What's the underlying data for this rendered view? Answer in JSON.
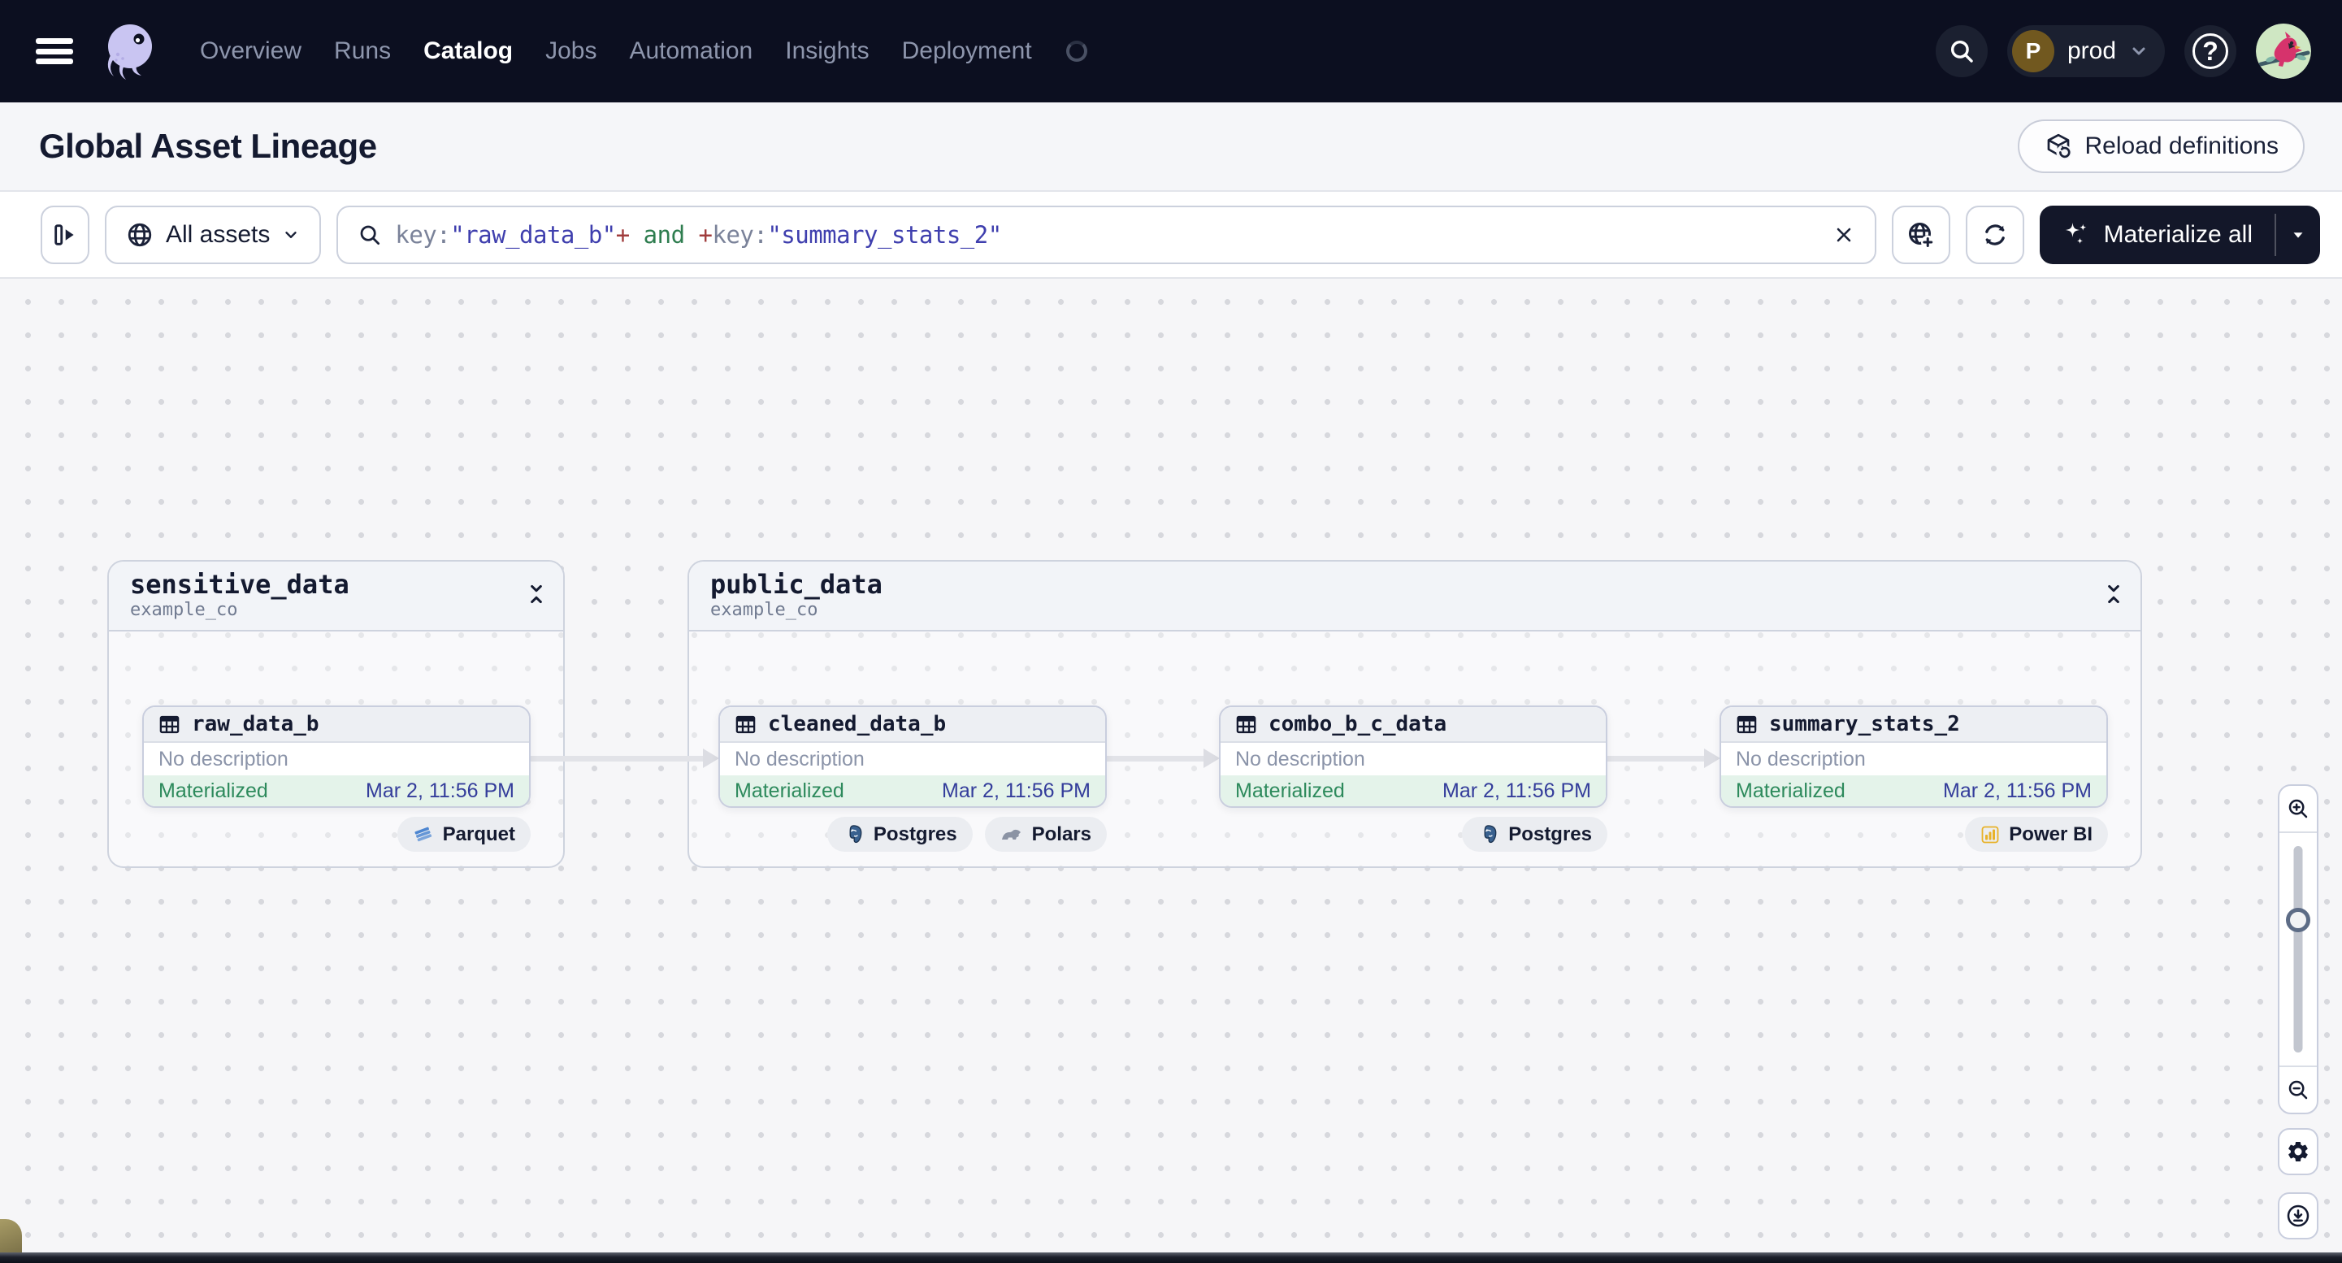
{
  "navbar": {
    "brand": "Dagster",
    "items": [
      {
        "label": "Overview",
        "active": false
      },
      {
        "label": "Runs",
        "active": false
      },
      {
        "label": "Catalog",
        "active": true
      },
      {
        "label": "Jobs",
        "active": false
      },
      {
        "label": "Automation",
        "active": false
      },
      {
        "label": "Insights",
        "active": false
      },
      {
        "label": "Deployment",
        "active": false
      }
    ],
    "deployment": {
      "initial": "P",
      "name": "prod"
    },
    "help_glyph": "?"
  },
  "page_header": {
    "title": "Global Asset Lineage",
    "reload_label": "Reload definitions"
  },
  "toolbar": {
    "scope_label": "All assets",
    "query": {
      "full": "key:\"raw_data_b\"+ and +key:\"summary_stats_2\"",
      "parts": [
        {
          "text": "key:",
          "kind": "field"
        },
        {
          "text": "\"raw_data_b\"",
          "kind": "value"
        },
        {
          "text": "+",
          "kind": "plus"
        },
        {
          "text": " and ",
          "kind": "and"
        },
        {
          "text": "+",
          "kind": "plus"
        },
        {
          "text": "key:",
          "kind": "field"
        },
        {
          "text": "\"summary_stats_2\"",
          "kind": "value"
        }
      ]
    },
    "materialize_label": "Materialize all"
  },
  "graph": {
    "groups": [
      {
        "name": "sensitive_data",
        "location": "example_co"
      },
      {
        "name": "public_data",
        "location": "example_co"
      }
    ],
    "nodes": [
      {
        "name": "raw_data_b",
        "description": "No description",
        "status": "Materialized",
        "materialized_at": "Mar 2, 11:56 PM",
        "group": "sensitive_data",
        "badges": [
          {
            "label": "Parquet",
            "icon": "parquet-icon"
          }
        ]
      },
      {
        "name": "cleaned_data_b",
        "description": "No description",
        "status": "Materialized",
        "materialized_at": "Mar 2, 11:56 PM",
        "group": "public_data",
        "badges": [
          {
            "label": "Postgres",
            "icon": "postgres-icon"
          },
          {
            "label": "Polars",
            "icon": "polars-icon"
          }
        ]
      },
      {
        "name": "combo_b_c_data",
        "description": "No description",
        "status": "Materialized",
        "materialized_at": "Mar 2, 11:56 PM",
        "group": "public_data",
        "badges": [
          {
            "label": "Postgres",
            "icon": "postgres-icon"
          }
        ]
      },
      {
        "name": "summary_stats_2",
        "description": "No description",
        "status": "Materialized",
        "materialized_at": "Mar 2, 11:56 PM",
        "group": "public_data",
        "badges": [
          {
            "label": "Power BI",
            "icon": "powerbi-icon"
          }
        ]
      }
    ],
    "edges": [
      {
        "from": "raw_data_b",
        "to": "cleaned_data_b"
      },
      {
        "from": "cleaned_data_b",
        "to": "combo_b_c_data"
      },
      {
        "from": "combo_b_c_data",
        "to": "summary_stats_2"
      }
    ]
  },
  "colors": {
    "navbar_bg": "#0c0f20",
    "accent_dark": "#131729",
    "status_green": "#2d8a5c",
    "status_bg": "#e4f3ea",
    "timestamp_indigo": "#343d9b",
    "query_field": "#7a8299",
    "query_value": "#3f3fae",
    "query_plus": "#a03c3c",
    "query_and": "#2e7d4f",
    "canvas_bg": "#f6f6f8"
  }
}
